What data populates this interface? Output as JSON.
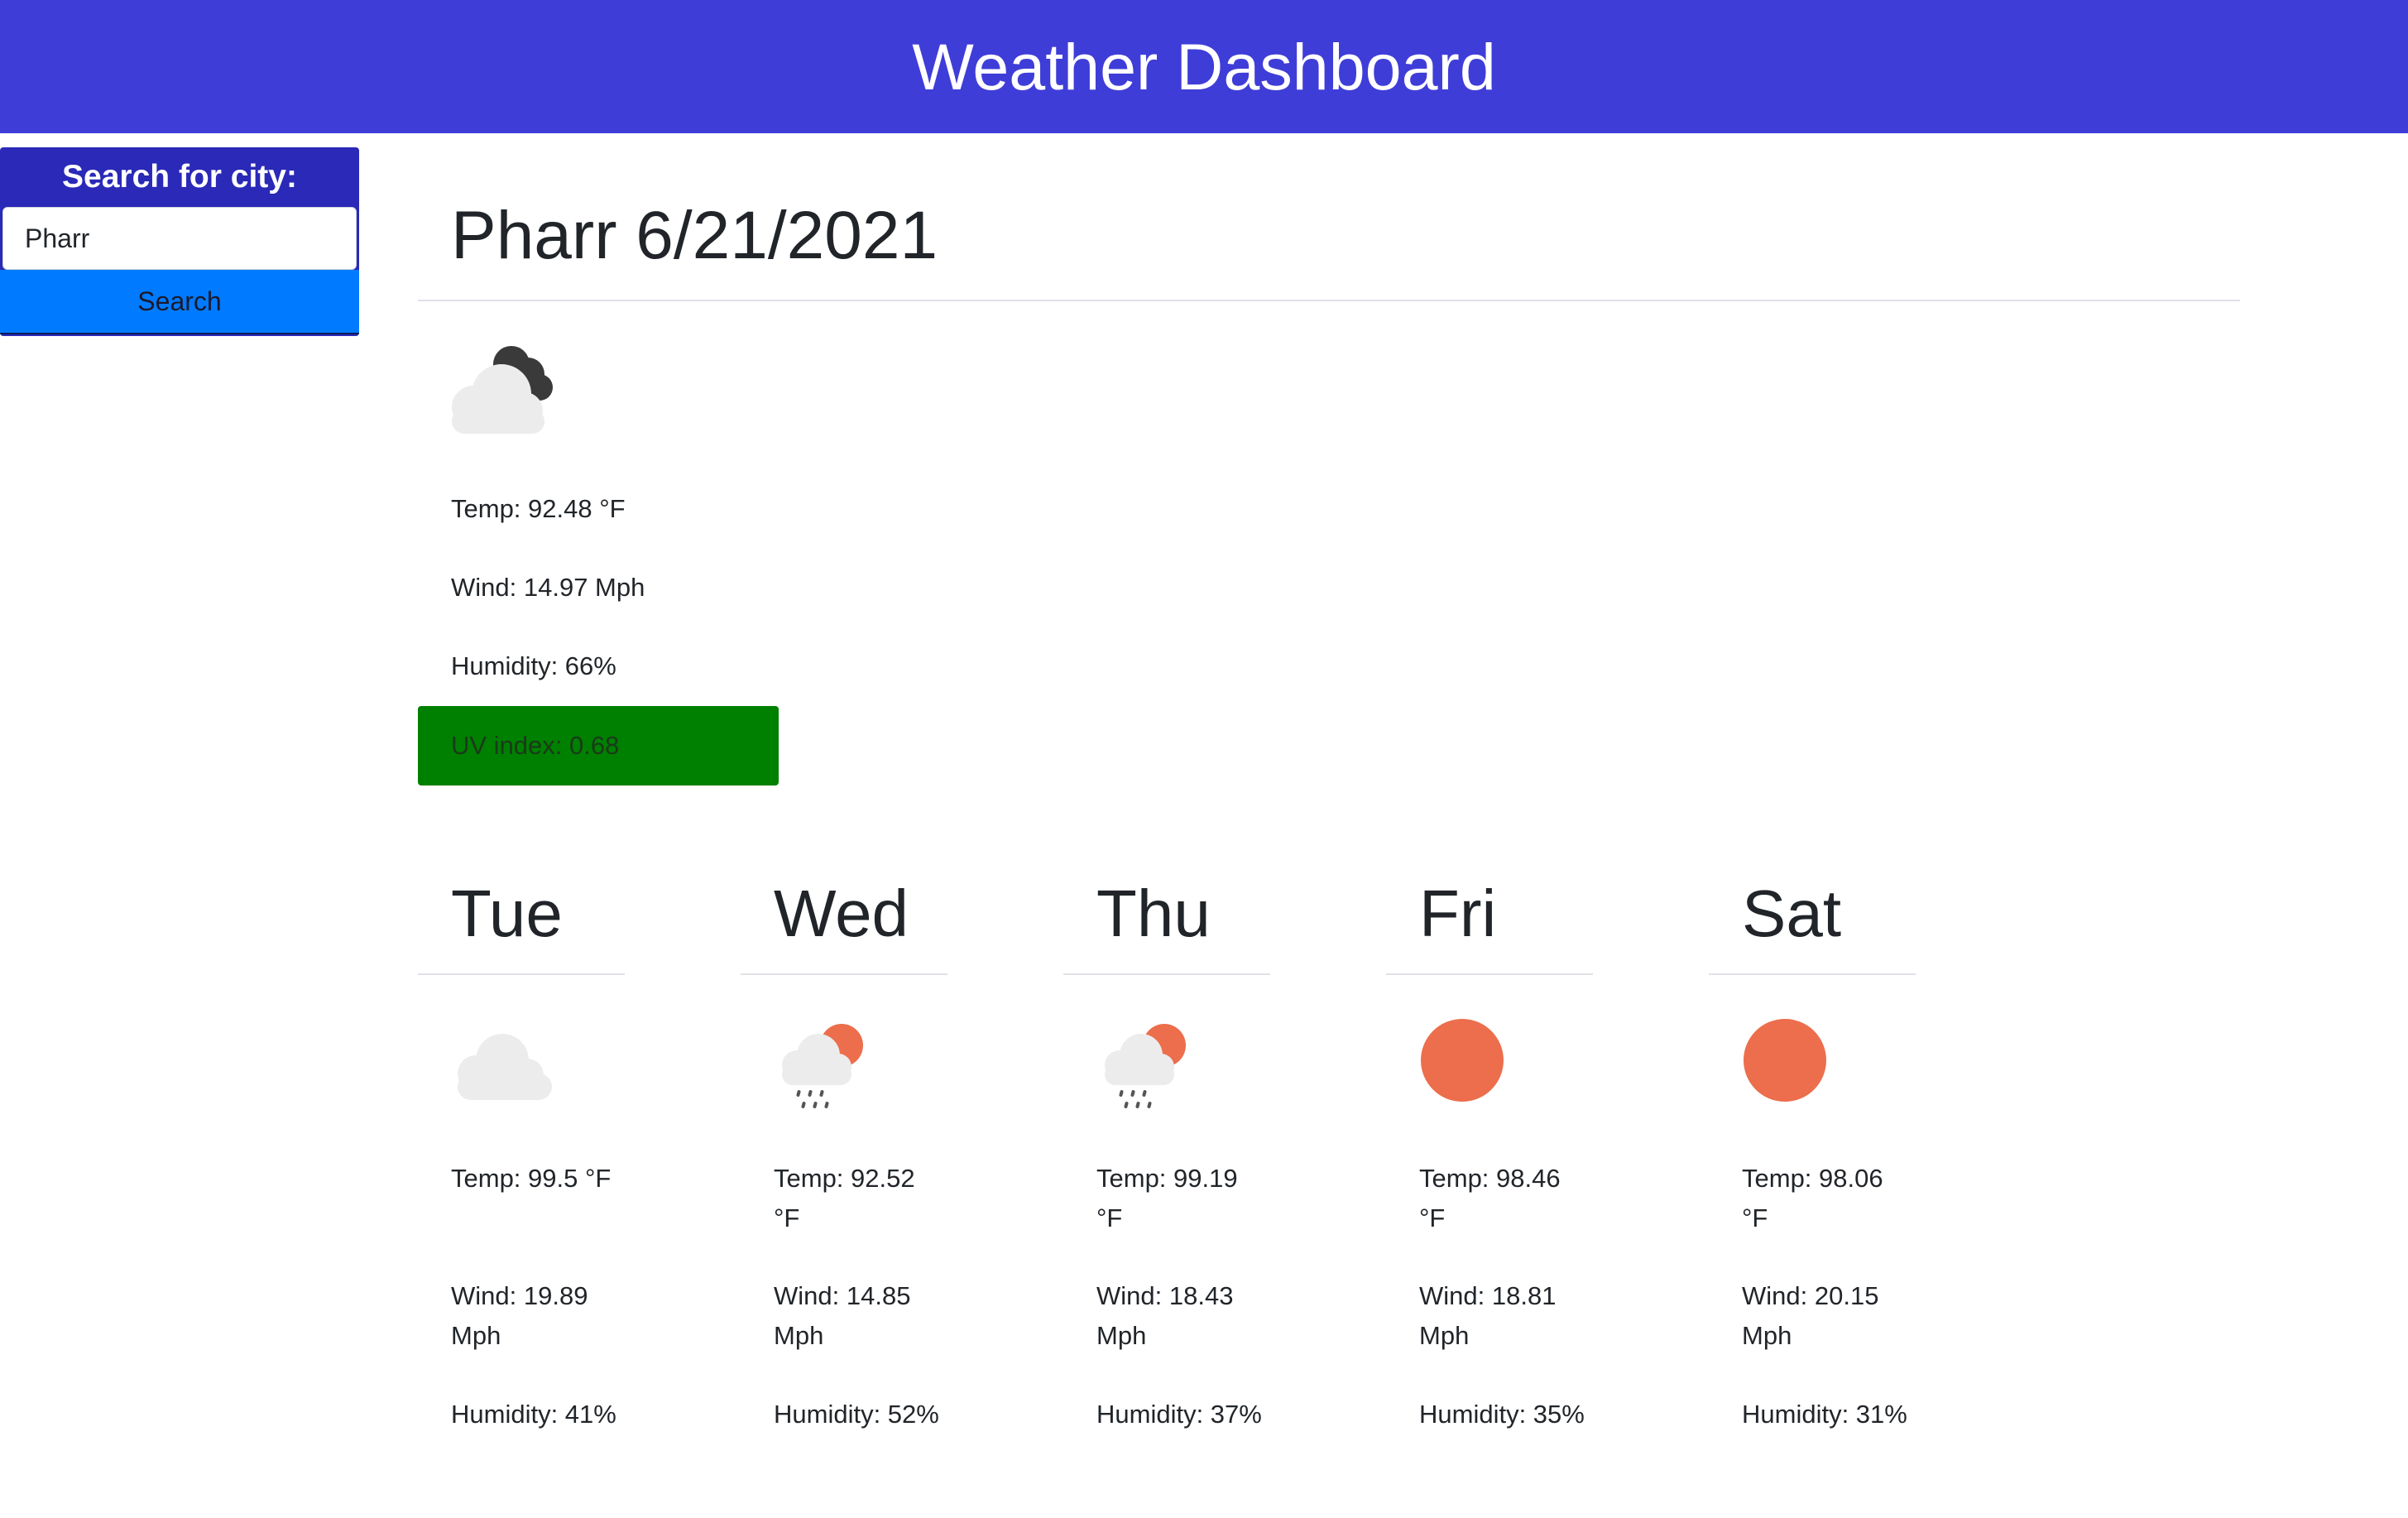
{
  "header": {
    "title": "Weather Dashboard"
  },
  "search": {
    "label": "Search for city:",
    "value": "Pharr",
    "button_label": "Search"
  },
  "current": {
    "title": "Pharr 6/21/2021",
    "icon": "cloudy-dark-icon",
    "temp": "Temp: 92.48 °F",
    "wind": "Wind: 14.97 Mph",
    "humidity": "Humidity: 66%",
    "uv": "UV index: 0.68",
    "uv_color": "#008000"
  },
  "forecast": [
    {
      "day": "Tue",
      "icon": "cloud-icon",
      "temp": "Temp: 99.5 °F",
      "wind": "Wind: 19.89 Mph",
      "humidity": "Humidity: 41%"
    },
    {
      "day": "Wed",
      "icon": "rain-sun-icon",
      "temp": "Temp: 92.52 °F",
      "wind": "Wind: 14.85 Mph",
      "humidity": "Humidity: 52%"
    },
    {
      "day": "Thu",
      "icon": "rain-sun-icon",
      "temp": "Temp: 99.19 °F",
      "wind": "Wind: 18.43 Mph",
      "humidity": "Humidity: 37%"
    },
    {
      "day": "Fri",
      "icon": "sun-icon",
      "temp": "Temp: 98.46 °F",
      "wind": "Wind: 18.81 Mph",
      "humidity": "Humidity: 35%"
    },
    {
      "day": "Sat",
      "icon": "sun-icon",
      "temp": "Temp: 98.06 °F",
      "wind": "Wind: 20.15 Mph",
      "humidity": "Humidity: 31%"
    }
  ],
  "colors": {
    "header_bg": "#3f3dd8",
    "search_panel_bg": "#2a29b8",
    "search_button_bg": "#007bff",
    "sun": "#ec6e4c"
  }
}
